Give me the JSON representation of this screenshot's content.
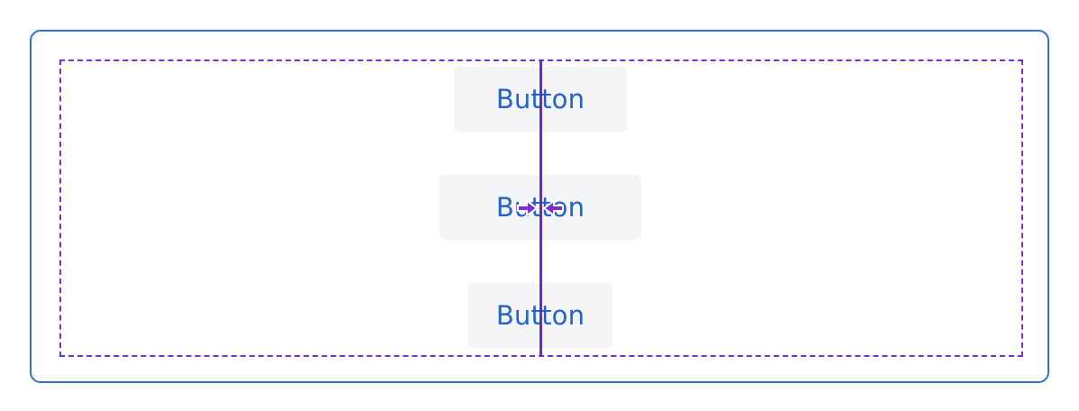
{
  "buttons": [
    {
      "label": "Button"
    },
    {
      "label": "Button"
    },
    {
      "label": "Button"
    }
  ],
  "colors": {
    "frame_border": "#2f6fd6",
    "selection_border": "#7a2fd0",
    "guide_line": "#6d28c9",
    "button_text": "#2563c9",
    "button_bg": "#f3f4f6"
  },
  "icons": {
    "center_align_arrows": "align-center-arrows-icon"
  }
}
